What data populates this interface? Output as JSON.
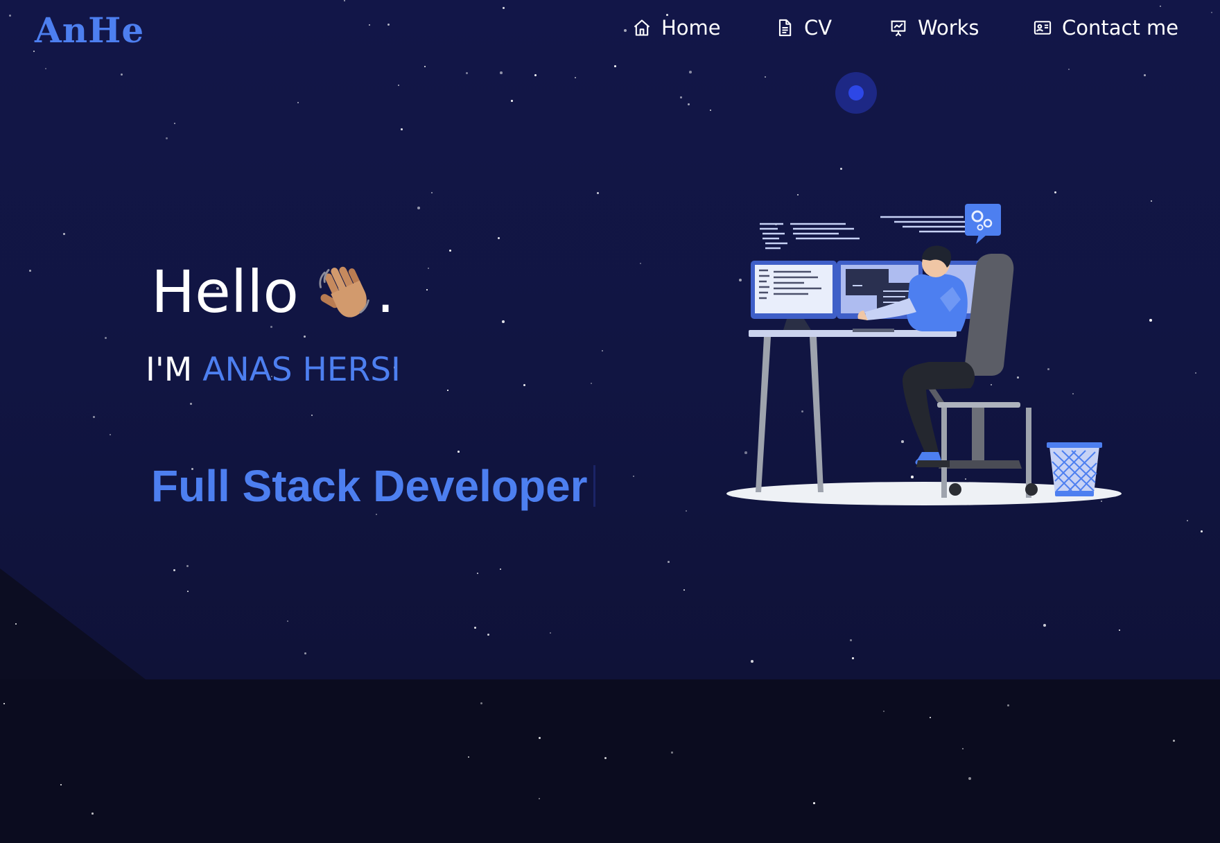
{
  "brand": {
    "logo": "AnHe"
  },
  "nav": {
    "items": [
      {
        "label": "Home",
        "icon": "home-icon"
      },
      {
        "label": "CV",
        "icon": "document-icon"
      },
      {
        "label": "Works",
        "icon": "presentation-chart-icon"
      },
      {
        "label": "Contact me",
        "icon": "contact-card-icon"
      }
    ]
  },
  "hero": {
    "greeting": "Hello",
    "greeting_emoji": "waving-hand-icon",
    "greeting_suffix": ".",
    "intro_prefix": "I'M",
    "name": "ANAS HERSI",
    "role": "Full Stack Developer"
  },
  "colors": {
    "accent": "#4d7ff0",
    "hero_background": "#121648",
    "page_background": "#0b0c1f",
    "text": "#ffffff"
  }
}
